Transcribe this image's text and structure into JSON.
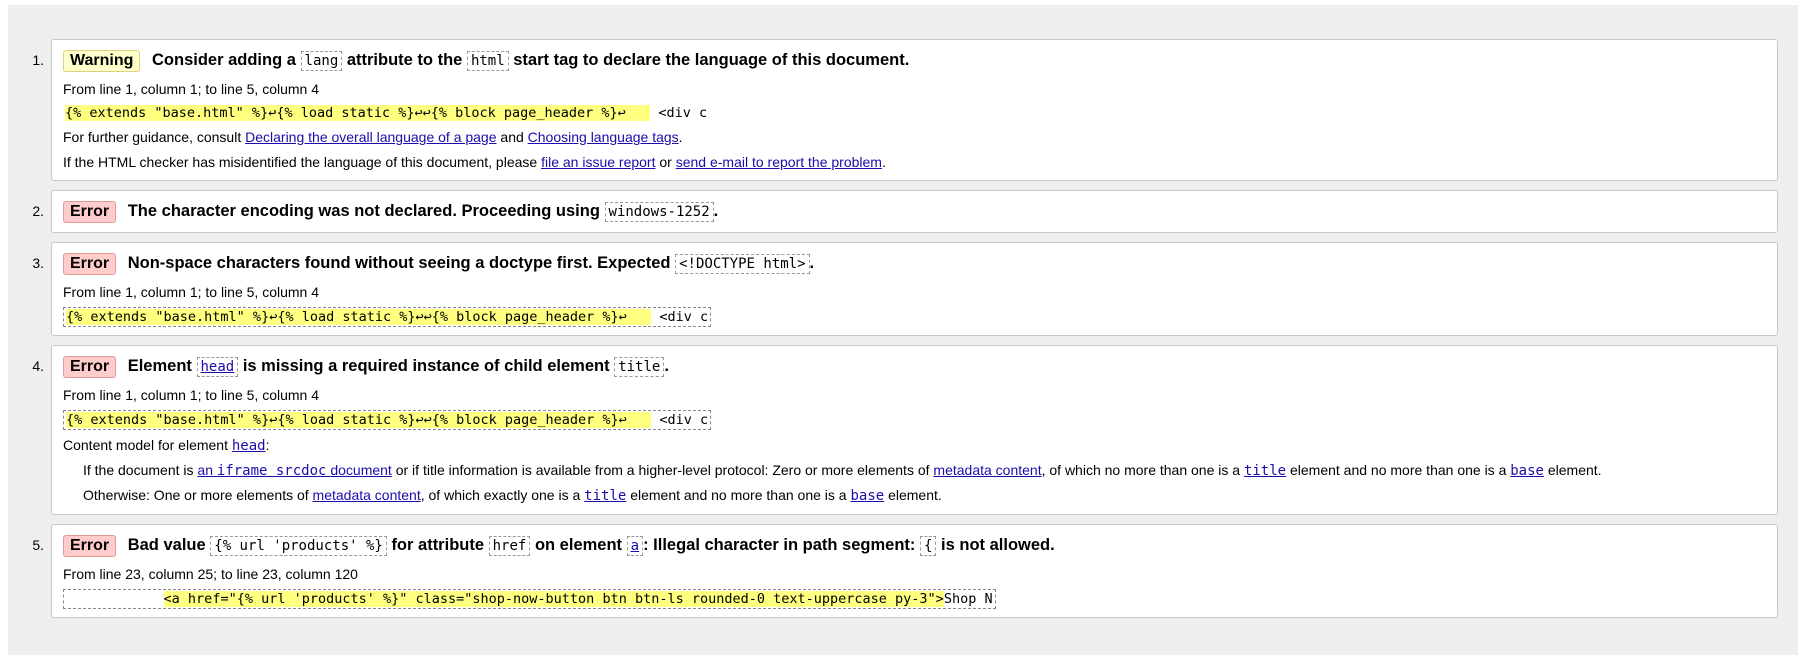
{
  "messages": [
    {
      "number": "1.",
      "type": "Warning",
      "title_parts": [
        "Consider adding a",
        "lang",
        "attribute to the",
        "html",
        "start tag to declare the language of this document."
      ],
      "location": "From line 1, column 1; to line 5, column 4",
      "extract": {
        "highlight": "{% extends \"base.html\" %}↩{% load static %}↩↩{% block page_header %}↩   ",
        "after": " <div c"
      },
      "guidance": {
        "prefix": "For further guidance, consult",
        "link1": "Declaring the overall language of a page",
        "middle": "and",
        "link2": "Choosing language tags",
        "suffix": "."
      },
      "report": {
        "prefix": "If the HTML checker has misidentified the language of this document, please",
        "link1": "file an issue report",
        "middle": "or",
        "link2": "send e-mail to report the problem",
        "suffix": "."
      }
    },
    {
      "number": "2.",
      "type": "Error",
      "title_text": "The character encoding was not declared. Proceeding using",
      "title_code": "windows-1252",
      "title_end": "."
    },
    {
      "number": "3.",
      "type": "Error",
      "title_text": "Non-space characters found without seeing a doctype first. Expected",
      "title_code": "<!DOCTYPE html>",
      "title_end": ".",
      "location": "From line 1, column 1; to line 5, column 4",
      "extract": {
        "highlight": "{% extends \"base.html\" %}↩{% load static %}↩↩{% block page_header %}↩   ",
        "after": " <div c"
      }
    },
    {
      "number": "4.",
      "type": "Error",
      "title_parts": [
        "Element",
        "head",
        "is missing a required instance of child element",
        "title",
        "."
      ],
      "location": "From line 1, column 1; to line 5, column 4",
      "extract": {
        "highlight": "{% extends \"base.html\" %}↩{% load static %}↩↩{% block page_header %}↩   ",
        "after": " <div c"
      },
      "content_model": {
        "prefix": "Content model for element",
        "link": "head",
        "suffix": ":"
      },
      "rule1": {
        "t1": "If the document is",
        "link1": "an",
        "link1_code": "iframe srcdoc",
        "link1_end": "document",
        "t2": "or if title information is available from a higher-level protocol: Zero or more elements of",
        "link2": "metadata content",
        "t3": ", of which no more than one is a",
        "link3": "title",
        "t4": "element and no more than one is a",
        "link4": "base",
        "t5": "element."
      },
      "rule2": {
        "t1": "Otherwise: One or more elements of",
        "link1": "metadata content",
        "t2": ", of which exactly one is a",
        "link2": "title",
        "t3": "element and no more than one is a",
        "link3": "base",
        "t4": "element."
      }
    },
    {
      "number": "5.",
      "type": "Error",
      "title_parts": [
        "Bad value",
        "{% url 'products' %}",
        "for attribute",
        "href",
        "on element",
        "a",
        ": Illegal character in path segment:",
        "{",
        "is not allowed."
      ],
      "location": "From line 23, column 25; to line 23, column 120",
      "extract": {
        "before": "            ",
        "highlight": "<a href=\"{% url 'products' %}\" class=\"shop-now-button btn btn-ls rounded-0 text-uppercase py-3\">",
        "after": "Shop N"
      }
    }
  ]
}
